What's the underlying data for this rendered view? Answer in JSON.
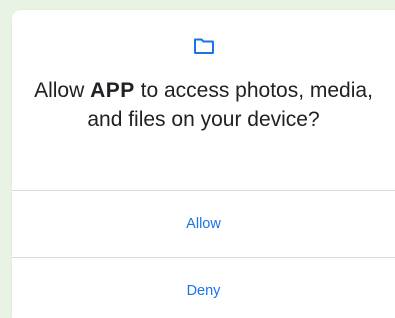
{
  "dialog": {
    "icon": "folder-icon",
    "message_prefix": "Allow ",
    "app_name": "APP",
    "message_suffix": " to access photos, media, and files on your device?",
    "allow_label": "Allow",
    "deny_label": "Deny"
  },
  "colors": {
    "background": "#e8f3e3",
    "accent": "#1a73e8",
    "text": "#202124",
    "divider": "#dadce0"
  }
}
